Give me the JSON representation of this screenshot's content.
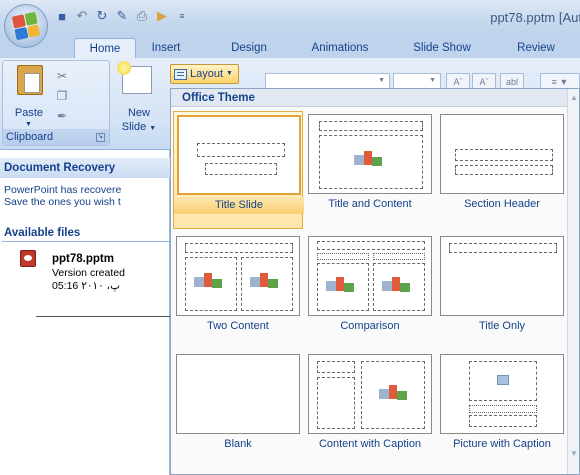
{
  "window": {
    "title": "ppt78.pptm [Aut"
  },
  "qat": {
    "items": [
      "save",
      "undo",
      "redo",
      "new-slide",
      "open"
    ]
  },
  "tabs": [
    {
      "label": "Home",
      "active": true
    },
    {
      "label": "Insert",
      "active": false
    },
    {
      "label": "Design",
      "active": false
    },
    {
      "label": "Animations",
      "active": false
    },
    {
      "label": "Slide Show",
      "active": false
    },
    {
      "label": "Review",
      "active": false
    }
  ],
  "ribbon": {
    "clipboard": {
      "paste_label": "Paste",
      "group_label": "Clipboard"
    },
    "new_slide": {
      "label": "New",
      "label2": "Slide"
    },
    "layout_button": "Layout",
    "font_btns": [
      "Aˆ",
      "Aˇ",
      "abl"
    ]
  },
  "recovery": {
    "header": "Document Recovery",
    "line1": "PowerPoint has recovere",
    "line2": "Save the ones you wish t",
    "available": "Available files",
    "file_name": "ppt78.pptm",
    "file_meta1": "Version created",
    "file_meta2": "05:16 ۲۰۱۰ ،پ"
  },
  "gallery": {
    "header": "Office Theme",
    "layouts": [
      {
        "label": "Title Slide",
        "selected": true
      },
      {
        "label": "Title and Content",
        "selected": false
      },
      {
        "label": "Section Header",
        "selected": false
      },
      {
        "label": "Two Content",
        "selected": false
      },
      {
        "label": "Comparison",
        "selected": false
      },
      {
        "label": "Title Only",
        "selected": false
      },
      {
        "label": "Blank",
        "selected": false
      },
      {
        "label": "Content with Caption",
        "selected": false
      },
      {
        "label": "Picture with Caption",
        "selected": false
      }
    ]
  },
  "colors": {
    "accent": "#15428b",
    "ribbon": "#d4e3f5",
    "selected": "#fde6a8",
    "selected_border": "#e4a23b"
  }
}
